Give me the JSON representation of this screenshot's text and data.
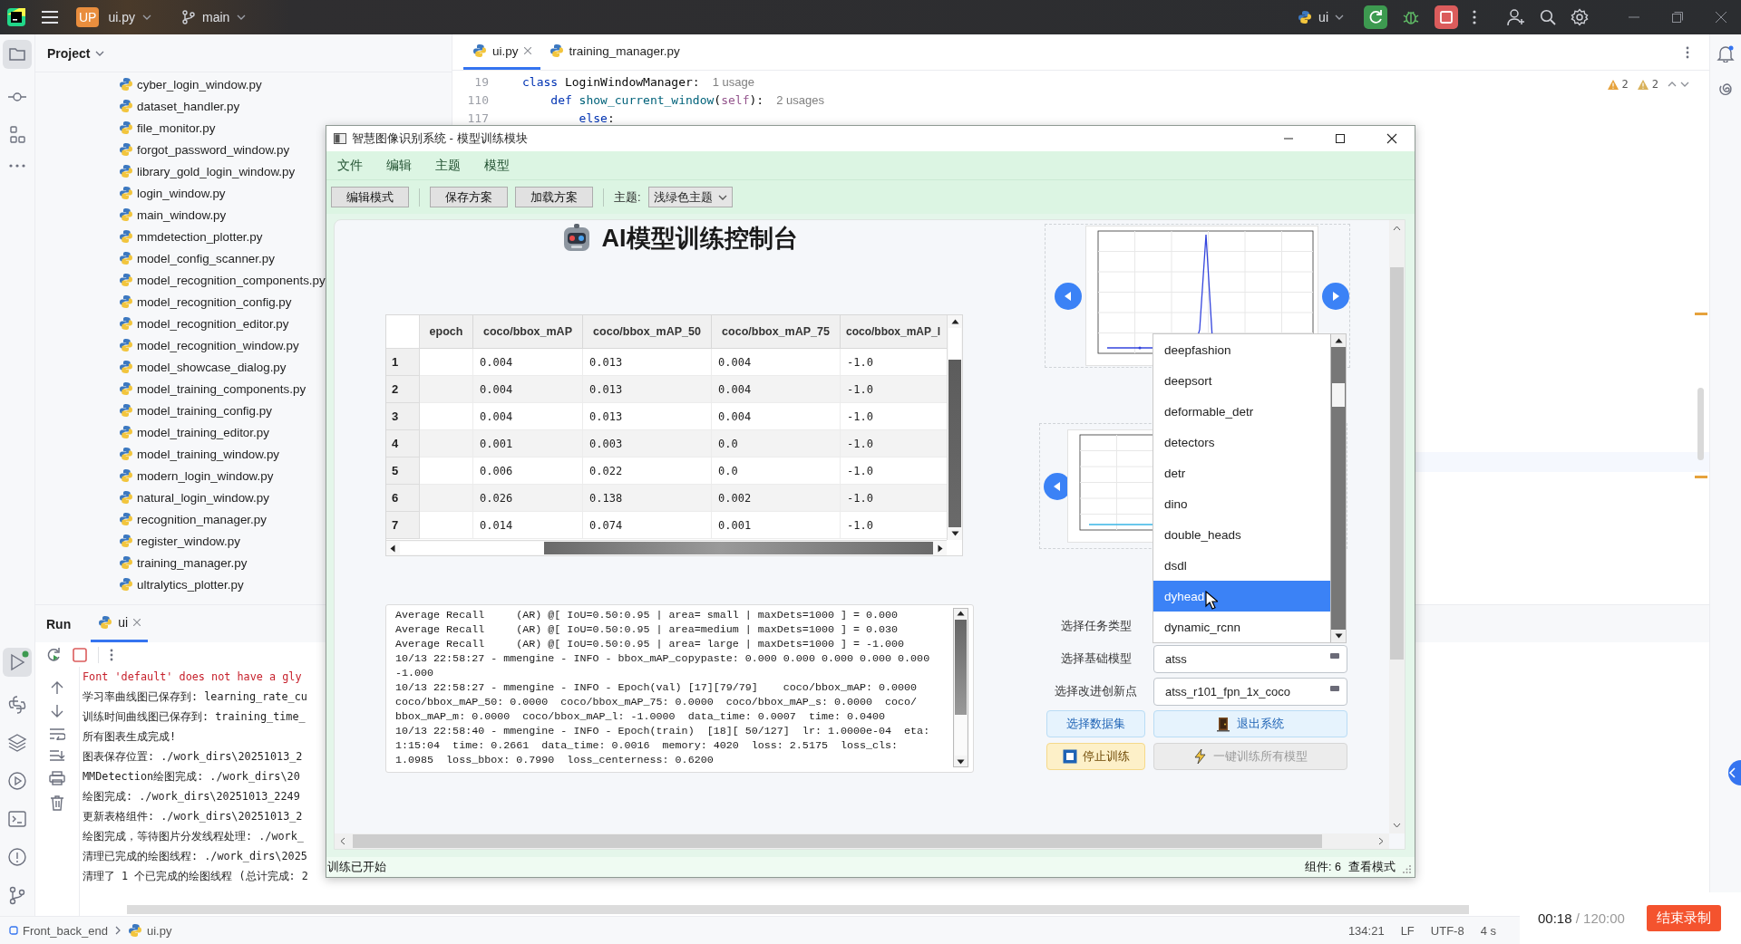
{
  "ide": {
    "topbar": {
      "project_badge": "UP",
      "project": "ui.py",
      "branch": "main",
      "run_config": "ui"
    },
    "project_panel": {
      "title": "Project",
      "files": [
        "cyber_login_window.py",
        "dataset_handler.py",
        "file_monitor.py",
        "forgot_password_window.py",
        "library_gold_login_window.py",
        "login_window.py",
        "main_window.py",
        "mmdetection_plotter.py",
        "model_config_scanner.py",
        "model_recognition_components.py",
        "model_recognition_config.py",
        "model_recognition_editor.py",
        "model_recognition_window.py",
        "model_showcase_dialog.py",
        "model_training_components.py",
        "model_training_config.py",
        "model_training_editor.py",
        "model_training_window.py",
        "modern_login_window.py",
        "natural_login_window.py",
        "recognition_manager.py",
        "register_window.py",
        "training_manager.py",
        "ultralytics_plotter.py"
      ]
    },
    "editor": {
      "tabs": [
        {
          "label": "ui.py",
          "selected": true
        },
        {
          "label": "training_manager.py",
          "selected": false
        }
      ],
      "inspections": [
        {
          "kind": "warning",
          "count": "2"
        },
        {
          "kind": "weak_warning",
          "count": "2"
        }
      ],
      "lines": [
        {
          "number": "19",
          "hint": "1 usage",
          "tokens": [
            {
              "kind": "keyword",
              "text": "class"
            },
            {
              "kind": "plain",
              "text": " LoginWindowManager:"
            }
          ]
        },
        {
          "number": "110",
          "hint": "2 usages",
          "tokens": [
            {
              "kind": "keyword",
              "text": "    def"
            },
            {
              "kind": "function",
              "text": " show_current_window"
            },
            {
              "kind": "plain",
              "text": "("
            },
            {
              "kind": "self",
              "text": "self"
            },
            {
              "kind": "plain",
              "text": "):"
            }
          ]
        },
        {
          "number": "117",
          "tokens": [
            {
              "kind": "keyword",
              "text": "        else"
            },
            {
              "kind": "plain",
              "text": ":"
            }
          ]
        }
      ]
    },
    "run_panel": {
      "title": "Run",
      "tabs": [
        {
          "label": "ui",
          "selected": true
        }
      ],
      "output": [
        {
          "kind": "error",
          "text": "Font 'default' does not have a gly"
        },
        {
          "kind": "info",
          "text": "学习率曲线图已保存到: learning_rate_cu"
        },
        {
          "kind": "info",
          "text": "训练时间曲线图已保存到: training_time_"
        },
        {
          "kind": "info",
          "text": "所有图表生成完成!"
        },
        {
          "kind": "info",
          "text": "图表保存位置: ./work_dirs\\20251013_2"
        },
        {
          "kind": "info",
          "text": "MMDetection绘图完成: ./work_dirs\\20"
        },
        {
          "kind": "info",
          "text": "绘图完成: ./work_dirs\\20251013_2249"
        },
        {
          "kind": "info",
          "text": "更新表格组件: ./work_dirs\\20251013_2"
        },
        {
          "kind": "info",
          "text": "绘图完成，等待图片分发线程处理: ./work_"
        },
        {
          "kind": "info",
          "text": "清理已完成的绘图线程: ./work_dirs\\2025"
        },
        {
          "kind": "info",
          "text": "清理了 1 个已完成的绘图线程 (总计完成: 2"
        }
      ]
    },
    "status_bar": {
      "path": [
        "Front_back_end",
        "ui.py"
      ],
      "items": [
        "134:21",
        "LF",
        "UTF-8",
        "4 s"
      ]
    }
  },
  "recorder": {
    "elapsed": "00:18",
    "separator": "/",
    "limit": "120:00",
    "button": "结束录制"
  },
  "app_window": {
    "title": "智慧图像识别系统 - 模型训练模块",
    "menu": [
      "文件",
      "编辑",
      "主题",
      "模型"
    ],
    "toolbar": {
      "groups": [
        [
          "编辑模式"
        ],
        [
          "保存方案",
          "加载方案"
        ]
      ],
      "theme_label": "主题:",
      "theme_value": "浅绿色主题"
    },
    "heading": "AI模型训练控制台",
    "table": {
      "columns": [
        "epoch",
        "coco/bbox_mAP",
        "coco/bbox_mAP_50",
        "coco/bbox_mAP_75",
        "coco/bbox_mAP_l"
      ],
      "rows": [
        {
          "header": "1",
          "cells": [
            "",
            "0.004",
            "0.013",
            "0.004",
            "-1.0"
          ]
        },
        {
          "header": "2",
          "cells": [
            "",
            "0.004",
            "0.013",
            "0.004",
            "-1.0"
          ]
        },
        {
          "header": "3",
          "cells": [
            "",
            "0.004",
            "0.013",
            "0.004",
            "-1.0"
          ]
        },
        {
          "header": "4",
          "cells": [
            "",
            "0.001",
            "0.003",
            "0.0",
            "-1.0"
          ]
        },
        {
          "header": "5",
          "cells": [
            "",
            "0.006",
            "0.022",
            "0.0",
            "-1.0"
          ]
        },
        {
          "header": "6",
          "cells": [
            "",
            "0.026",
            "0.138",
            "0.002",
            "-1.0"
          ]
        },
        {
          "header": "7",
          "cells": [
            "",
            "0.014",
            "0.074",
            "0.001",
            "-1.0"
          ]
        }
      ]
    },
    "log": [
      "Average Recall     (AR) @[ IoU=0.50:0.95 | area= small | maxDets=1000 ] = 0.000",
      "Average Recall     (AR) @[ IoU=0.50:0.95 | area=medium | maxDets=1000 ] = 0.030",
      "Average Recall     (AR) @[ IoU=0.50:0.95 | area= large | maxDets=1000 ] = -1.000",
      "10/13 22:58:27 - mmengine - INFO - bbox_mAP_copypaste: 0.000 0.000 0.000 0.000 0.000",
      "-1.000",
      "10/13 22:58:27 - mmengine - INFO - Epoch(val) [17][79/79]    coco/bbox_mAP: 0.0000",
      "coco/bbox_mAP_50: 0.0000  coco/bbox_mAP_75: 0.0000  coco/bbox_mAP_s: 0.0000  coco/",
      "bbox_mAP_m: 0.0000  coco/bbox_mAP_l: -1.0000  data_time: 0.0007  time: 0.0400",
      "10/13 22:58:40 - mmengine - INFO - Epoch(train)  [18][ 50/127]  lr: 1.0000e-04  eta:",
      "1:15:04  time: 0.2661  data_time: 0.0016  memory: 4020  loss: 2.5175  loss_cls:",
      "1.0985  loss_bbox: 0.7990  loss_centerness: 0.6200"
    ],
    "carousels": [
      {
        "kind": "spike"
      },
      {
        "kind": "flat"
      }
    ],
    "dropdown": [
      {
        "label": "deepfashion",
        "selected": false
      },
      {
        "label": "deepsort",
        "selected": false
      },
      {
        "label": "deformable_detr",
        "selected": false
      },
      {
        "label": "detectors",
        "selected": false
      },
      {
        "label": "detr",
        "selected": false
      },
      {
        "label": "dino",
        "selected": false
      },
      {
        "label": "double_heads",
        "selected": false
      },
      {
        "label": "dsdl",
        "selected": false
      },
      {
        "label": "dyhead",
        "selected": true
      },
      {
        "label": "dynamic_rcnn",
        "selected": false
      }
    ],
    "fields": [
      {
        "label": "选择任务类型"
      },
      {
        "label": "选择基础模型",
        "value": "atss"
      },
      {
        "label": "选择改进创新点",
        "value": "atss_r101_fpn_1x_coco"
      }
    ],
    "buttons": [
      {
        "kind": "dataset",
        "label": "选择数据集",
        "disabled": false
      },
      {
        "kind": "exit",
        "label": "退出系统",
        "disabled": false
      },
      {
        "kind": "stop",
        "label": "停止训练",
        "disabled": false
      },
      {
        "kind": "train_all",
        "label": "一键训练所有模型",
        "disabled": true
      }
    ],
    "status": {
      "message": "训练已开始",
      "items": [
        "组件: 6",
        "查看模式"
      ]
    }
  }
}
